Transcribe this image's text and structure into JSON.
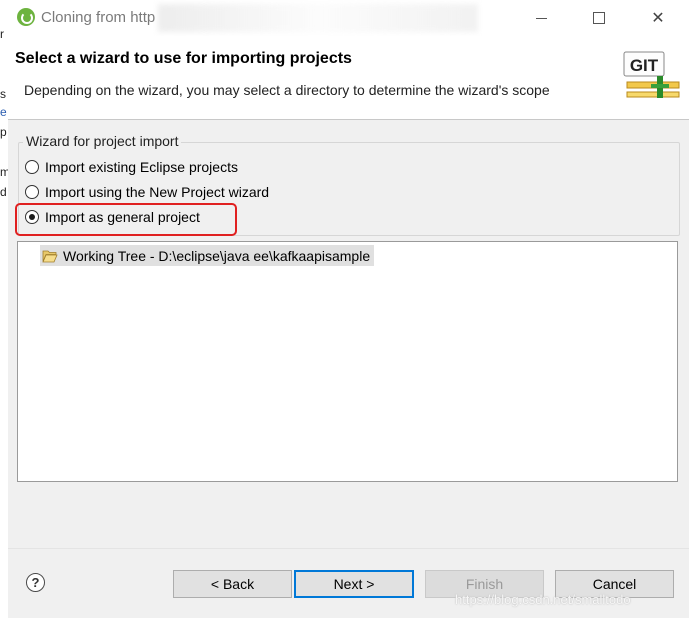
{
  "window": {
    "title": "Cloning from http",
    "minimize_icon": "minimize-icon",
    "maximize_icon": "maximize-icon",
    "close_glyph": "✕"
  },
  "background_fragments": [
    "r",
    "s",
    "e",
    "p",
    "m",
    "d"
  ],
  "header": {
    "title": "Select a wizard to use for importing projects",
    "description": "Depending on the wizard, you may select a directory to determine the wizard's scope",
    "logo_text": "GIT"
  },
  "wizard_group": {
    "label": "Wizard for project import",
    "options": [
      {
        "label": "Import existing Eclipse projects",
        "selected": false
      },
      {
        "label": "Import using the New Project wizard",
        "selected": false
      },
      {
        "label": "Import as general project",
        "selected": true
      }
    ]
  },
  "tree": {
    "items": [
      {
        "label": "Working Tree - D:\\eclipse\\java ee\\kafkaapisample",
        "icon": "folder-open-icon",
        "selected": true
      }
    ]
  },
  "footer": {
    "help_glyph": "?",
    "back_label": "< Back",
    "next_label": "Next >",
    "finish_label": "Finish",
    "cancel_label": "Cancel"
  },
  "watermark": "https://blog.csdn.net/smalltodo",
  "colors": {
    "accent": "#0078d7",
    "highlight": "#e02020",
    "selection": "#e0e0e0"
  }
}
